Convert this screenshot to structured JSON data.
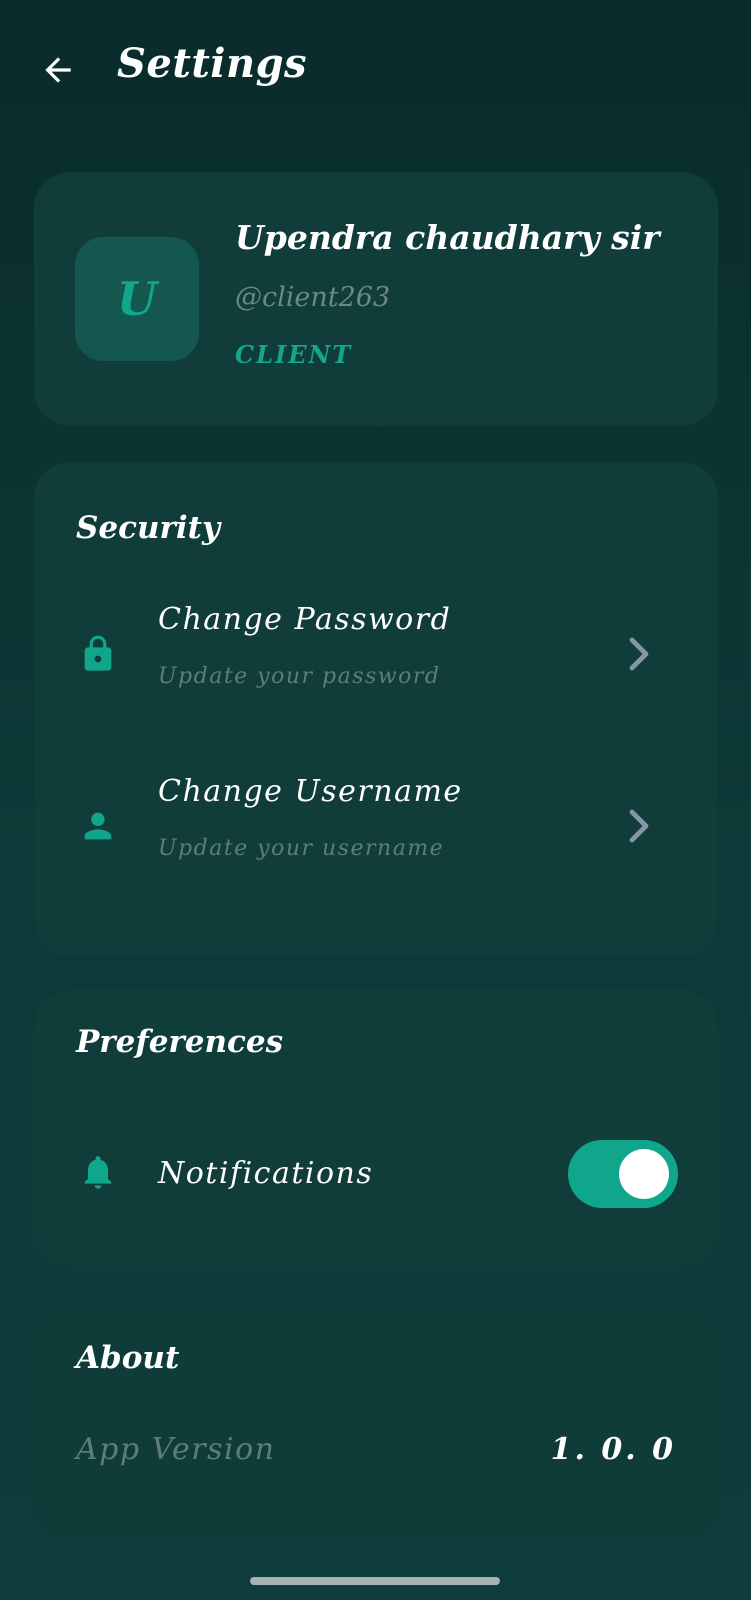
{
  "header": {
    "title": "Settings",
    "back_icon": "arrow-left-icon"
  },
  "profile": {
    "avatar_initial": "U",
    "name": "Upendra chaudhary sir",
    "handle": "@client263",
    "role": "CLIENT"
  },
  "security": {
    "title": "Security",
    "items": [
      {
        "label": "Change Password",
        "subtitle": "Update your password",
        "icon": "lock-icon"
      },
      {
        "label": "Change Username",
        "subtitle": "Update your username",
        "icon": "person-icon"
      }
    ]
  },
  "preferences": {
    "title": "Preferences",
    "notifications": {
      "label": "Notifications",
      "icon": "bell-icon",
      "enabled": true
    }
  },
  "about": {
    "title": "About",
    "version_label": "App Version",
    "version_value": "1. 0. 0"
  },
  "colors": {
    "accent": "#10a68b",
    "card": "#103c3a",
    "muted_text": "#5f7c7c",
    "background": "#0a2b2b"
  }
}
